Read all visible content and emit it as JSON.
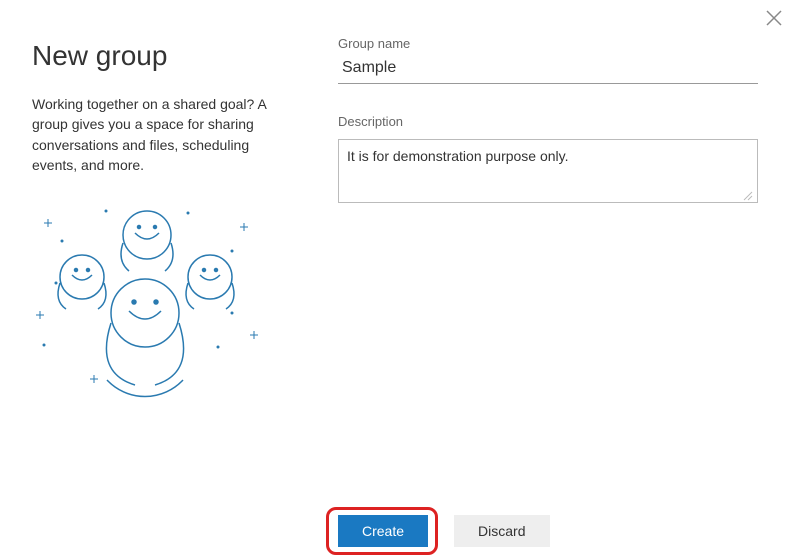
{
  "panel": {
    "title": "New group",
    "description": "Working together on a shared goal? A group gives you a space for sharing conversations and files, scheduling events, and more."
  },
  "form": {
    "groupName": {
      "label": "Group name",
      "value": "Sample"
    },
    "description": {
      "label": "Description",
      "value": "It is for demonstration purpose only."
    }
  },
  "buttons": {
    "create": "Create",
    "discard": "Discard"
  }
}
